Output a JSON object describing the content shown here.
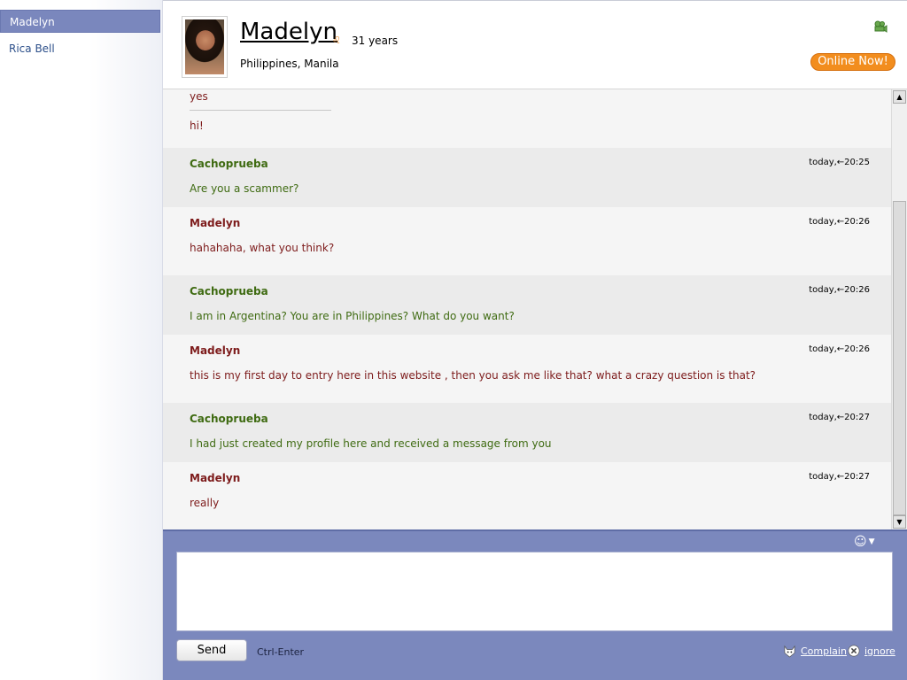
{
  "sidebar": {
    "contacts": [
      {
        "name": "Madelyn"
      },
      {
        "name": "Rica Bell"
      }
    ]
  },
  "profile": {
    "name": "Madelyn",
    "age": "31 years",
    "location": "Philippines, Manila",
    "status": "Online Now!"
  },
  "previous": {
    "line1": "yes",
    "line2": "hi!"
  },
  "messages": [
    {
      "author": "Cachoprueba",
      "time": "today,←20:25",
      "text": "Are you a scammer?"
    },
    {
      "author": "Madelyn",
      "time": "today,←20:26",
      "text": "hahahaha, what you think?"
    },
    {
      "author": "Cachoprueba",
      "time": "today,←20:26",
      "text": "I am in Argentina? You are in Philippines? What do you want?"
    },
    {
      "author": "Madelyn",
      "time": "today,←20:26",
      "text": "this is my first day to entry here in this website , then you ask me like that? what a crazy question is that?"
    },
    {
      "author": "Cachoprueba",
      "time": "today,←20:27",
      "text": "I had just created my profile here and received a message from you"
    },
    {
      "author": "Madelyn",
      "time": "today,←20:27",
      "text": "really"
    }
  ],
  "compose": {
    "value": "",
    "send_label": "Send",
    "hint": "Ctrl-Enter",
    "complain_label": "Complain",
    "ignore_label": "ignore"
  },
  "colors": {
    "sender_other": "#3f6b12",
    "sender_profile": "#7d1b1b",
    "accent": "#7b88bd",
    "online": "#f28d1e"
  }
}
